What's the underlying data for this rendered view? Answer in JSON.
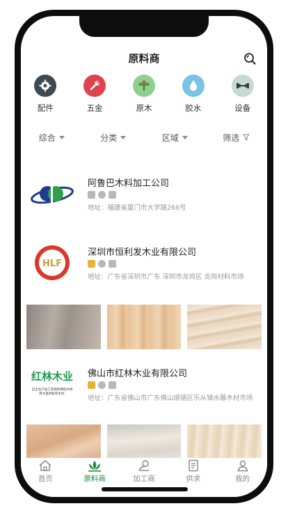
{
  "header": {
    "title": "原料商"
  },
  "categories": [
    {
      "label": "配件",
      "icon": "gear-icon",
      "color": "#3d4a52"
    },
    {
      "label": "五金",
      "icon": "wrench-icon",
      "color": "#e0424f"
    },
    {
      "label": "原木",
      "icon": "sapling-icon",
      "color": "#8fd08f"
    },
    {
      "label": "胶水",
      "icon": "droplet-icon",
      "color": "#78c3e6"
    },
    {
      "label": "设备",
      "icon": "dumbbell-icon",
      "color": "#c5dad4"
    }
  ],
  "filters": [
    {
      "label": "综合",
      "icon": "caret-down-icon"
    },
    {
      "label": "分类",
      "icon": "caret-down-icon"
    },
    {
      "label": "区域",
      "icon": "caret-down-icon"
    },
    {
      "label": "筛选",
      "icon": "funnel-icon"
    }
  ],
  "companies": [
    {
      "name": "阿鲁巴木料加工公司",
      "address": "地址：福建省厦门市大学路266号",
      "badge_colors": [
        "#b8b8b8",
        "#b8b8b8",
        "#b8b8b8"
      ]
    },
    {
      "name": "深圳市恒利发木业有限公司",
      "address": "地址：广东省深圳市广东 深圳市龙岗区 龙岗材料市场",
      "badge_colors": [
        "#e8b23a",
        "#b8b8b8",
        "#b8b8b8"
      ],
      "logo_text": "HLF"
    },
    {
      "name": "佛山市红林木业有限公司",
      "address": "地址：广东省佛山市广东佛山顺德区乐从镇水藤木材市场",
      "badge_colors": [
        "#e8b23a",
        "#b8b8b8",
        "#b8b8b8"
      ],
      "logo_text": "红林木业",
      "logo_subtext": "自主生产加工及销售橡胶木拼\n原木直拼板等木材."
    }
  ],
  "tabbar": [
    {
      "label": "首页",
      "icon": "home-icon"
    },
    {
      "label": "原料商",
      "icon": "lotus-icon",
      "active": true
    },
    {
      "label": "加工商",
      "icon": "factory-icon"
    },
    {
      "label": "供求",
      "icon": "document-icon"
    },
    {
      "label": "我的",
      "icon": "user-icon"
    }
  ],
  "colors": {
    "accent": "#1f8a3b",
    "wood_light": "#e8c7a0",
    "wood_gray": "#9a8f85"
  }
}
